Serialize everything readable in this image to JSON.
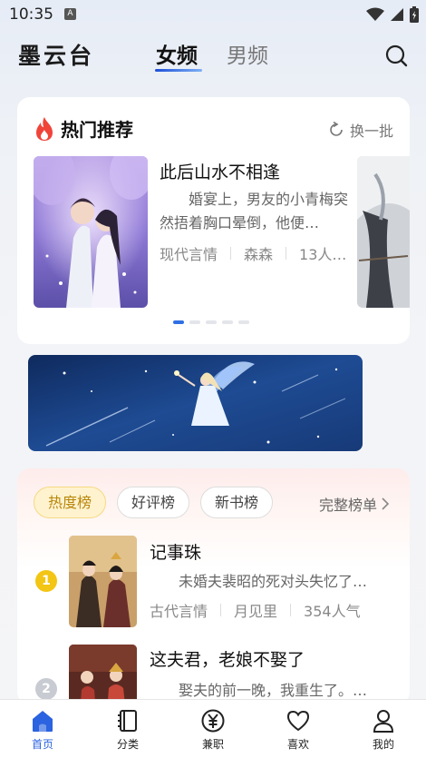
{
  "status_bar": {
    "time": "10:35",
    "notification_badge": "A"
  },
  "header": {
    "logo": "墨云台",
    "tabs": [
      {
        "label": "女频",
        "active": true
      },
      {
        "label": "男频",
        "active": false
      }
    ],
    "search_icon": "search-icon"
  },
  "hot": {
    "title": "热门推荐",
    "refresh_label": "换一批",
    "book": {
      "title": "此后山水不相逢",
      "description": "婚宴上，男友的小青梅突然捂着胸口晕倒，他便…",
      "category": "现代言情",
      "author": "森森",
      "popularity": "13人…"
    },
    "carousel_pages": 5,
    "carousel_active": 1
  },
  "ranking": {
    "tabs": [
      {
        "label": "热度榜",
        "active": true
      },
      {
        "label": "好评榜",
        "active": false
      },
      {
        "label": "新书榜",
        "active": false
      }
    ],
    "full_list_label": "完整榜单",
    "items": [
      {
        "rank": "1",
        "title": "记事珠",
        "description": "未婚夫裴昭的死对头失忆了…",
        "category": "古代言情",
        "author": "月见里",
        "popularity": "354人气"
      },
      {
        "rank": "2",
        "title": "这夫君，老娘不娶了",
        "description": "娶夫的前一晚，我重生了。…"
      }
    ]
  },
  "bottom_nav": [
    {
      "label": "首页",
      "icon": "home-icon",
      "active": true
    },
    {
      "label": "分类",
      "icon": "book-icon",
      "active": false
    },
    {
      "label": "兼职",
      "icon": "yen-icon",
      "active": false
    },
    {
      "label": "喜欢",
      "icon": "heart-icon",
      "active": false
    },
    {
      "label": "我的",
      "icon": "profile-icon",
      "active": false
    }
  ],
  "colors": {
    "accent": "#2b63e0",
    "rank_gold": "#f3c514",
    "rank_silver": "#c8cbd2",
    "hot_flame": "#f0443a"
  }
}
